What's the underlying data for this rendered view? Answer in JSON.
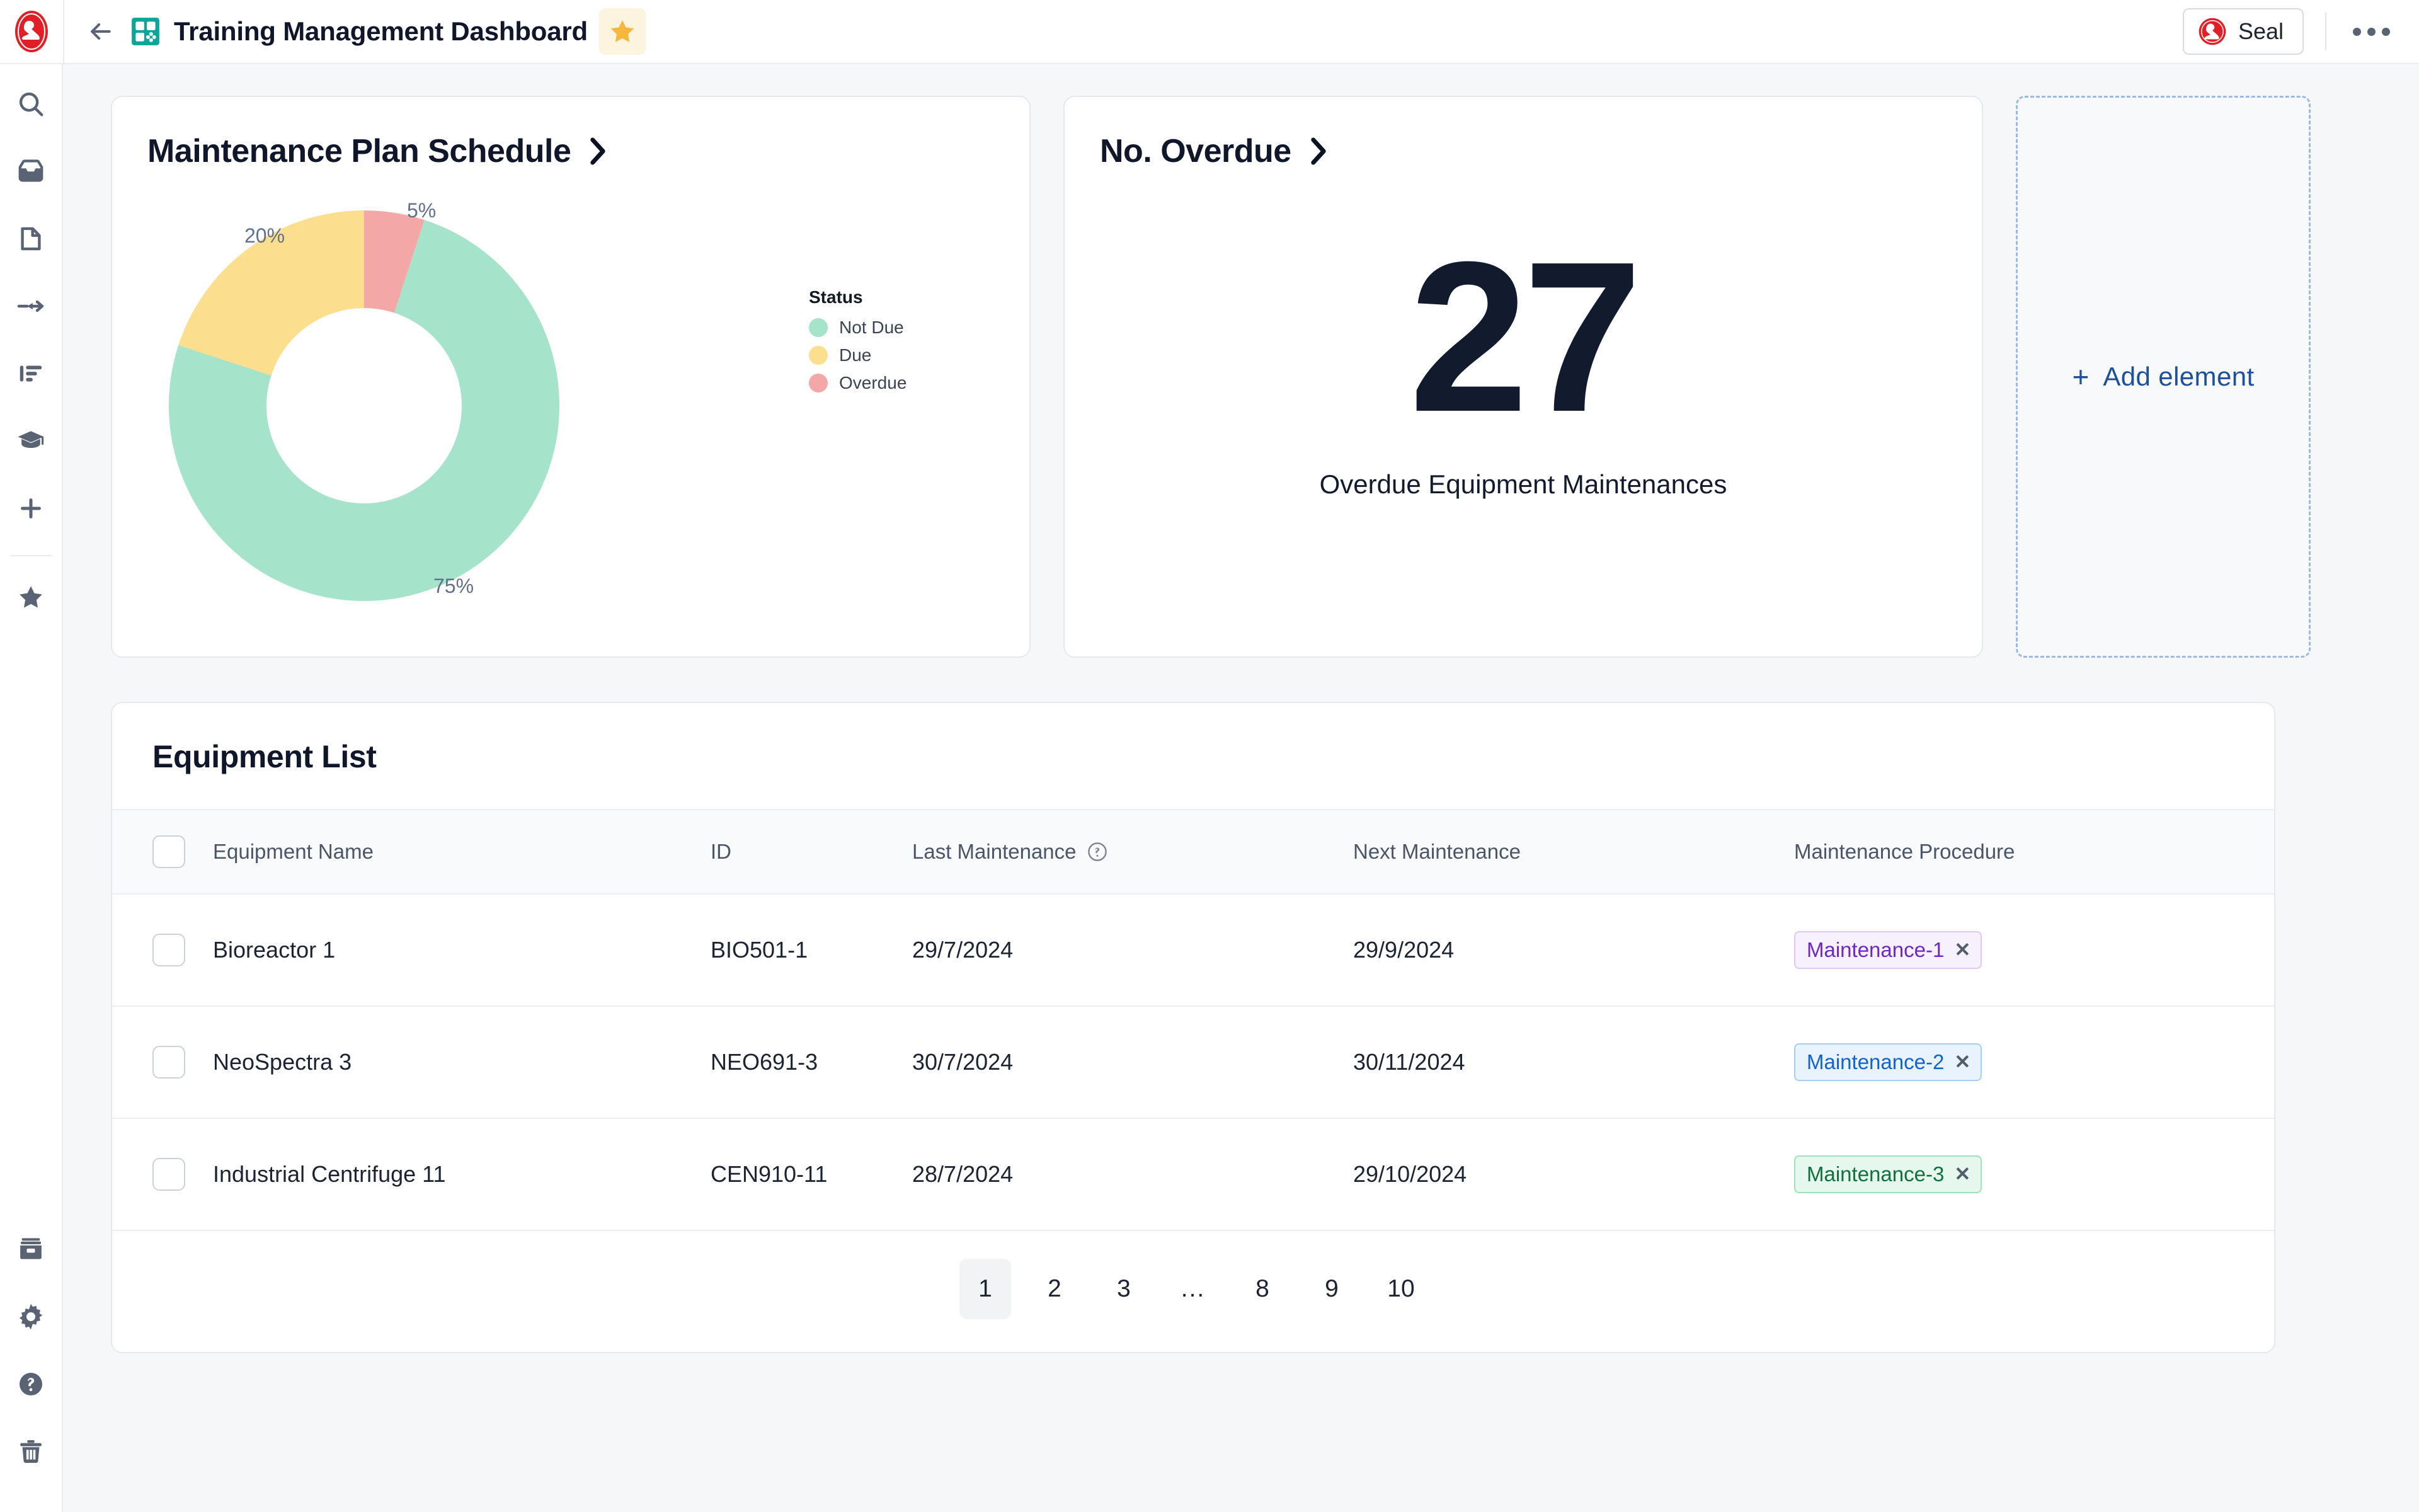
{
  "topbar": {
    "back_label": "Back",
    "app_icon": "dashboard-grid-icon",
    "doc_title": "Training Management Dashboard",
    "favorite_icon": "star-icon",
    "workspace_label": "Seal",
    "more_label": "More options"
  },
  "sidebar": {
    "items": [
      {
        "icon": "search-icon",
        "name": "search"
      },
      {
        "icon": "inbox-icon",
        "name": "inbox"
      },
      {
        "icon": "document-icon",
        "name": "documents"
      },
      {
        "icon": "workflow-arrow-icon",
        "name": "workflows"
      },
      {
        "icon": "list-icon",
        "name": "lists"
      },
      {
        "icon": "graduation-cap-icon",
        "name": "training"
      },
      {
        "icon": "plus-icon",
        "name": "create"
      },
      {
        "icon": "star-icon",
        "name": "favorites"
      }
    ],
    "bottom_items": [
      {
        "icon": "archive-icon",
        "name": "archive"
      },
      {
        "icon": "gear-icon",
        "name": "settings"
      },
      {
        "icon": "help-circle-icon",
        "name": "help"
      },
      {
        "icon": "trash-icon",
        "name": "trash"
      }
    ]
  },
  "chart_card": {
    "title": "Maintenance Plan Schedule",
    "chevron_icon": "chevron-right-icon"
  },
  "kpi_card": {
    "title": "No. Overdue",
    "chevron_icon": "chevron-right-icon",
    "value": "27",
    "caption": "Overdue Equipment Maintenances"
  },
  "add_element": {
    "plus": "+",
    "label": "Add element",
    "accent": "#1c4f9c"
  },
  "chart_data": {
    "type": "pie",
    "title": "Maintenance Plan Schedule",
    "legend_title": "Status",
    "legend_position": "right",
    "donut": true,
    "categories": [
      "Overdue",
      "Not Due",
      "Due"
    ],
    "values": [
      5,
      75,
      20
    ],
    "labels": [
      "5%",
      "75%",
      "20%"
    ],
    "colors": [
      "#f4a7a7",
      "#a5e3cb",
      "#fbdf8e"
    ],
    "legend": [
      {
        "label": "Not Due",
        "color": "#a5e3cb",
        "value": 75
      },
      {
        "label": "Due",
        "color": "#fbdf8e",
        "value": 20
      },
      {
        "label": "Overdue",
        "color": "#f4a7a7",
        "value": 5
      }
    ]
  },
  "table": {
    "title": "Equipment List",
    "select_all_name": "select-all-checkbox",
    "columns": [
      {
        "key": "name",
        "label": "Equipment Name"
      },
      {
        "key": "id",
        "label": "ID"
      },
      {
        "key": "last",
        "label": "Last Maintenance",
        "help_icon": "help-circle-icon"
      },
      {
        "key": "next",
        "label": "Next Maintenance"
      },
      {
        "key": "proc",
        "label": "Maintenance Procedure"
      }
    ],
    "rows": [
      {
        "name": "Bioreactor 1",
        "id": "BIO501-1",
        "last": "29/7/2024",
        "next": "29/9/2024",
        "proc": "Maintenance-1",
        "proc_remove": "✕",
        "proc_bg": "#f7f1fd",
        "proc_border": "#ddc8f5",
        "proc_fg": "#6f28c2"
      },
      {
        "name": "NeoSpectra 3",
        "id": "NEO691-3",
        "last": "30/7/2024",
        "next": "30/11/2024",
        "proc": "Maintenance-2",
        "proc_remove": "✕",
        "proc_bg": "#e9f3fe",
        "proc_border": "#a8cdf3",
        "proc_fg": "#1263d2"
      },
      {
        "name": "Industrial Centrifuge 11",
        "id": "CEN910-11",
        "last": "28/7/2024",
        "next": "29/10/2024",
        "proc": "Maintenance-3",
        "proc_remove": "✕",
        "proc_bg": "#e6f8ed",
        "proc_border": "#9fe0ba",
        "proc_fg": "#12703c"
      }
    ],
    "pagination": {
      "pages": [
        "1",
        "2",
        "3",
        "...",
        "8",
        "9",
        "10"
      ],
      "active": "1"
    }
  }
}
